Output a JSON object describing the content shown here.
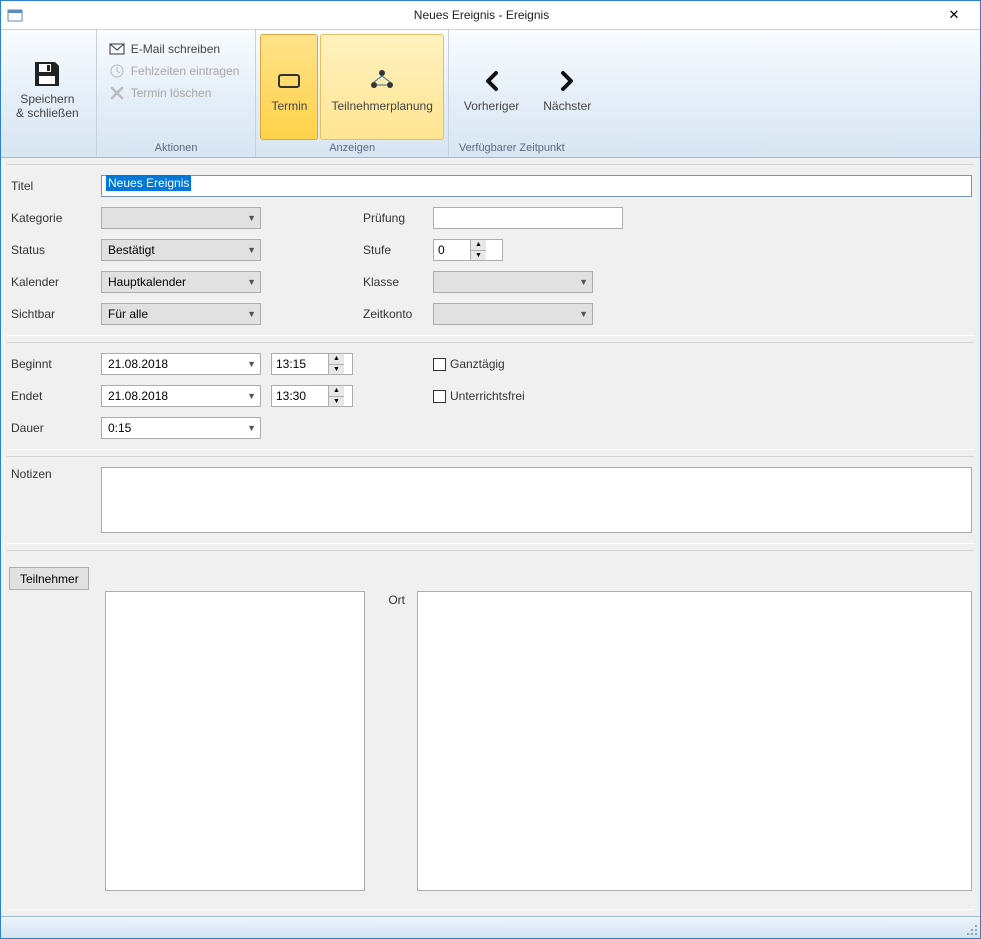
{
  "window": {
    "title": "Neues Ereignis - Ereignis"
  },
  "ribbon": {
    "save_close": "Speichern\n& schließen",
    "actions": {
      "email": "E-Mail schreiben",
      "absences": "Fehlzeiten eintragen",
      "delete": "Termin löschen",
      "label": "Aktionen"
    },
    "show": {
      "termin": "Termin",
      "teilnehmer": "Teilnehmerplanung",
      "label": "Anzeigen"
    },
    "avail": {
      "prev": "Vorheriger",
      "next": "Nächster",
      "label": "Verfügbarer Zeitpunkt"
    }
  },
  "labels": {
    "titel": "Titel",
    "kategorie": "Kategorie",
    "status": "Status",
    "kalender": "Kalender",
    "sichtbar": "Sichtbar",
    "pruefung": "Prüfung",
    "stufe": "Stufe",
    "klasse": "Klasse",
    "zeitkonto": "Zeitkonto",
    "beginnt": "Beginnt",
    "endet": "Endet",
    "dauer": "Dauer",
    "ganztaegig": "Ganztägig",
    "unterrichtsfrei": "Unterrichtsfrei",
    "notizen": "Notizen",
    "teilnehmer": "Teilnehmer",
    "ort": "Ort"
  },
  "values": {
    "titel": "Neues Ereignis",
    "kategorie": "",
    "status": "Bestätigt",
    "kalender": "Hauptkalender",
    "sichtbar": "Für alle",
    "pruefung": "",
    "stufe": "0",
    "klasse": "",
    "zeitkonto": "",
    "begin_date": "21.08.2018",
    "begin_time": "13:15",
    "end_date": "21.08.2018",
    "end_time": "13:30",
    "dauer": "0:15"
  }
}
